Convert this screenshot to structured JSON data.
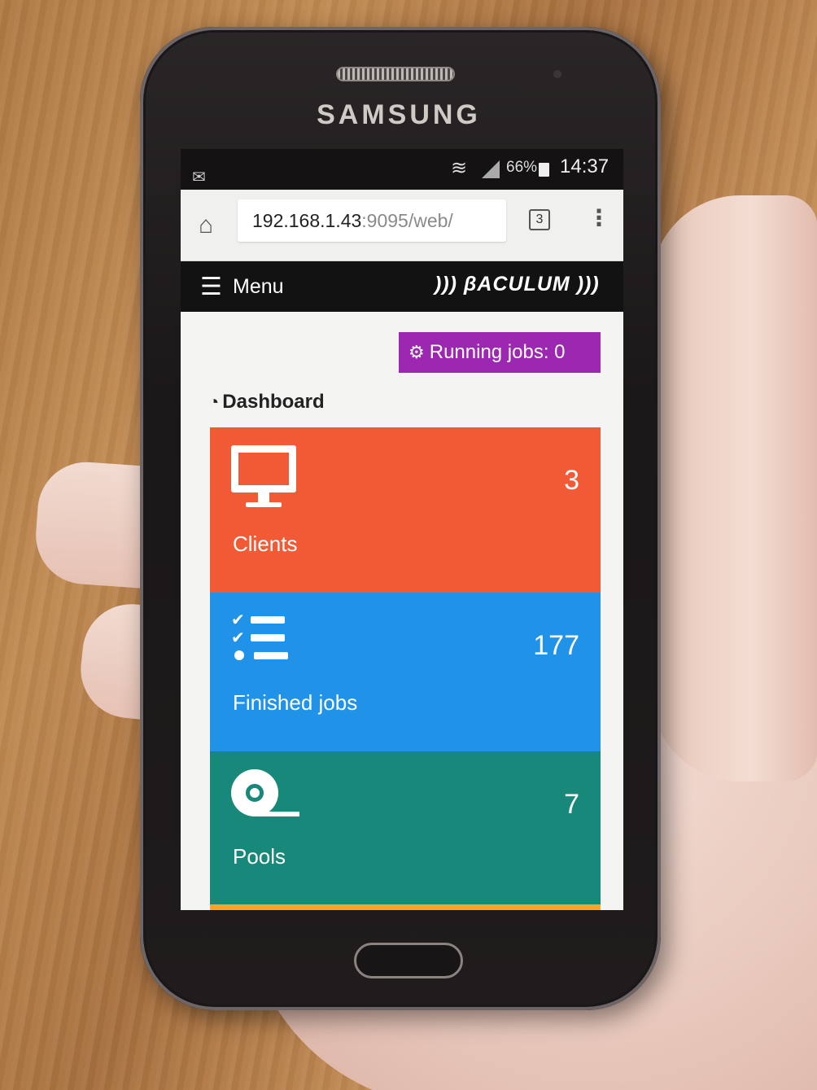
{
  "device": {
    "brand": "SAMSUNG"
  },
  "statusbar": {
    "battery": "66%",
    "time": "14:37"
  },
  "browser": {
    "url_host": "192.168.1.43",
    "url_rest": ":9095/web/",
    "tab_count": "3"
  },
  "navbar": {
    "menu_label": "Menu",
    "logo_text": "))) βACULUM )))"
  },
  "running_jobs": {
    "label": "Running jobs: 0"
  },
  "dashboard": {
    "title": "Dashboard",
    "tiles": [
      {
        "label": "Clients",
        "count": "3",
        "color": "#f15a35",
        "icon": "monitor-icon"
      },
      {
        "label": "Finished jobs",
        "count": "177",
        "color": "#2093e8",
        "icon": "checklist-icon"
      },
      {
        "label": "Pools",
        "count": "7",
        "color": "#17887a",
        "icon": "tape-icon"
      }
    ]
  },
  "colors": {
    "running_jobs_bg": "#9c27b0",
    "navbar_bg": "#121212"
  }
}
